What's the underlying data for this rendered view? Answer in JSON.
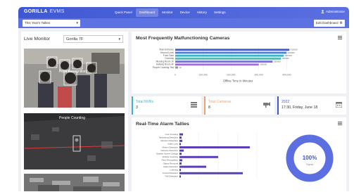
{
  "app": {
    "logo": "GORILLA",
    "logo_sub": "EVMS",
    "user": "Administrator"
  },
  "nav": [
    "Quick Panel",
    "Dashboard",
    "Monitor",
    "Device",
    "History",
    "Settings"
  ],
  "nav_active": "Dashboard",
  "subbar": {
    "period": "This Year's Tallies",
    "edit": "Edit Dashboard"
  },
  "live_monitor": {
    "title": "Live Monitor",
    "camera": "Gorilla 7F",
    "feeds": [
      {
        "label": "Face Recognition"
      },
      {
        "label": "People Counting"
      },
      {
        "label": ""
      }
    ]
  },
  "malfunction": {
    "title": "Most Frequently Malfunctioning Cameras",
    "chart_data": {
      "type": "bar",
      "orientation": "horizontal",
      "categories": [
        "Main Entrance",
        "Second Level",
        "Front Gate",
        "Doorway",
        "Meeting Room 1F",
        "Hallway Room 4F",
        "People Counting Test"
      ],
      "values": [
        410,
        400,
        390,
        380,
        350,
        300,
        10
      ],
      "colors": [
        "#3f58d2",
        "#4a7fd8",
        "#35b4c7",
        "#5bb8b0",
        "#7b6fd8",
        "#a06fd6",
        "#8f8fa8"
      ],
      "xlabel": "Offline Time in Minutes",
      "xticks": [
        "0",
        "100,000",
        "200,000",
        "300,000",
        "400,000"
      ],
      "xlim": [
        0,
        450
      ],
      "data_labels": [
        "410000",
        "400000",
        "390000",
        "380000",
        "350000",
        "300000",
        "10"
      ]
    }
  },
  "stats": [
    {
      "label": "Total NVRs",
      "value": "3",
      "color": "#35b4c7",
      "icon": "nvr-icon"
    },
    {
      "label": "Total Cameras",
      "value": "8",
      "color": "#f0a06a",
      "icon": "camera-icon"
    },
    {
      "label": "2022",
      "value": "17:30, Friday, June 18",
      "color": "#3f58d2",
      "icon": "calendar-icon"
    }
  ],
  "alarms": {
    "title": "Real-Time Alarm Tallies",
    "chart_data": {
      "type": "bar",
      "orientation": "horizontal",
      "categories": [
        "Line Crossing",
        "Tampering Detection",
        "Intrusion Detection",
        "Video Loss",
        "Motion Detection",
        "Defocus Detection",
        "Sudden Scene Change",
        "Vehicle Counting",
        "Face Recognition",
        "Object Removal",
        "Audio Detection",
        "Loitering",
        "Crowd Detection",
        "Fall Detection"
      ],
      "values": [
        5,
        3,
        4,
        2,
        100,
        6,
        3,
        55,
        4,
        3,
        38,
        2,
        90,
        2
      ],
      "bar_color": "#5a3fb8",
      "xlim": [
        0,
        110
      ]
    },
    "donut": {
      "percent": 100,
      "value_text": "100%",
      "label": "Tapas",
      "color": "#5b6fe0"
    }
  }
}
